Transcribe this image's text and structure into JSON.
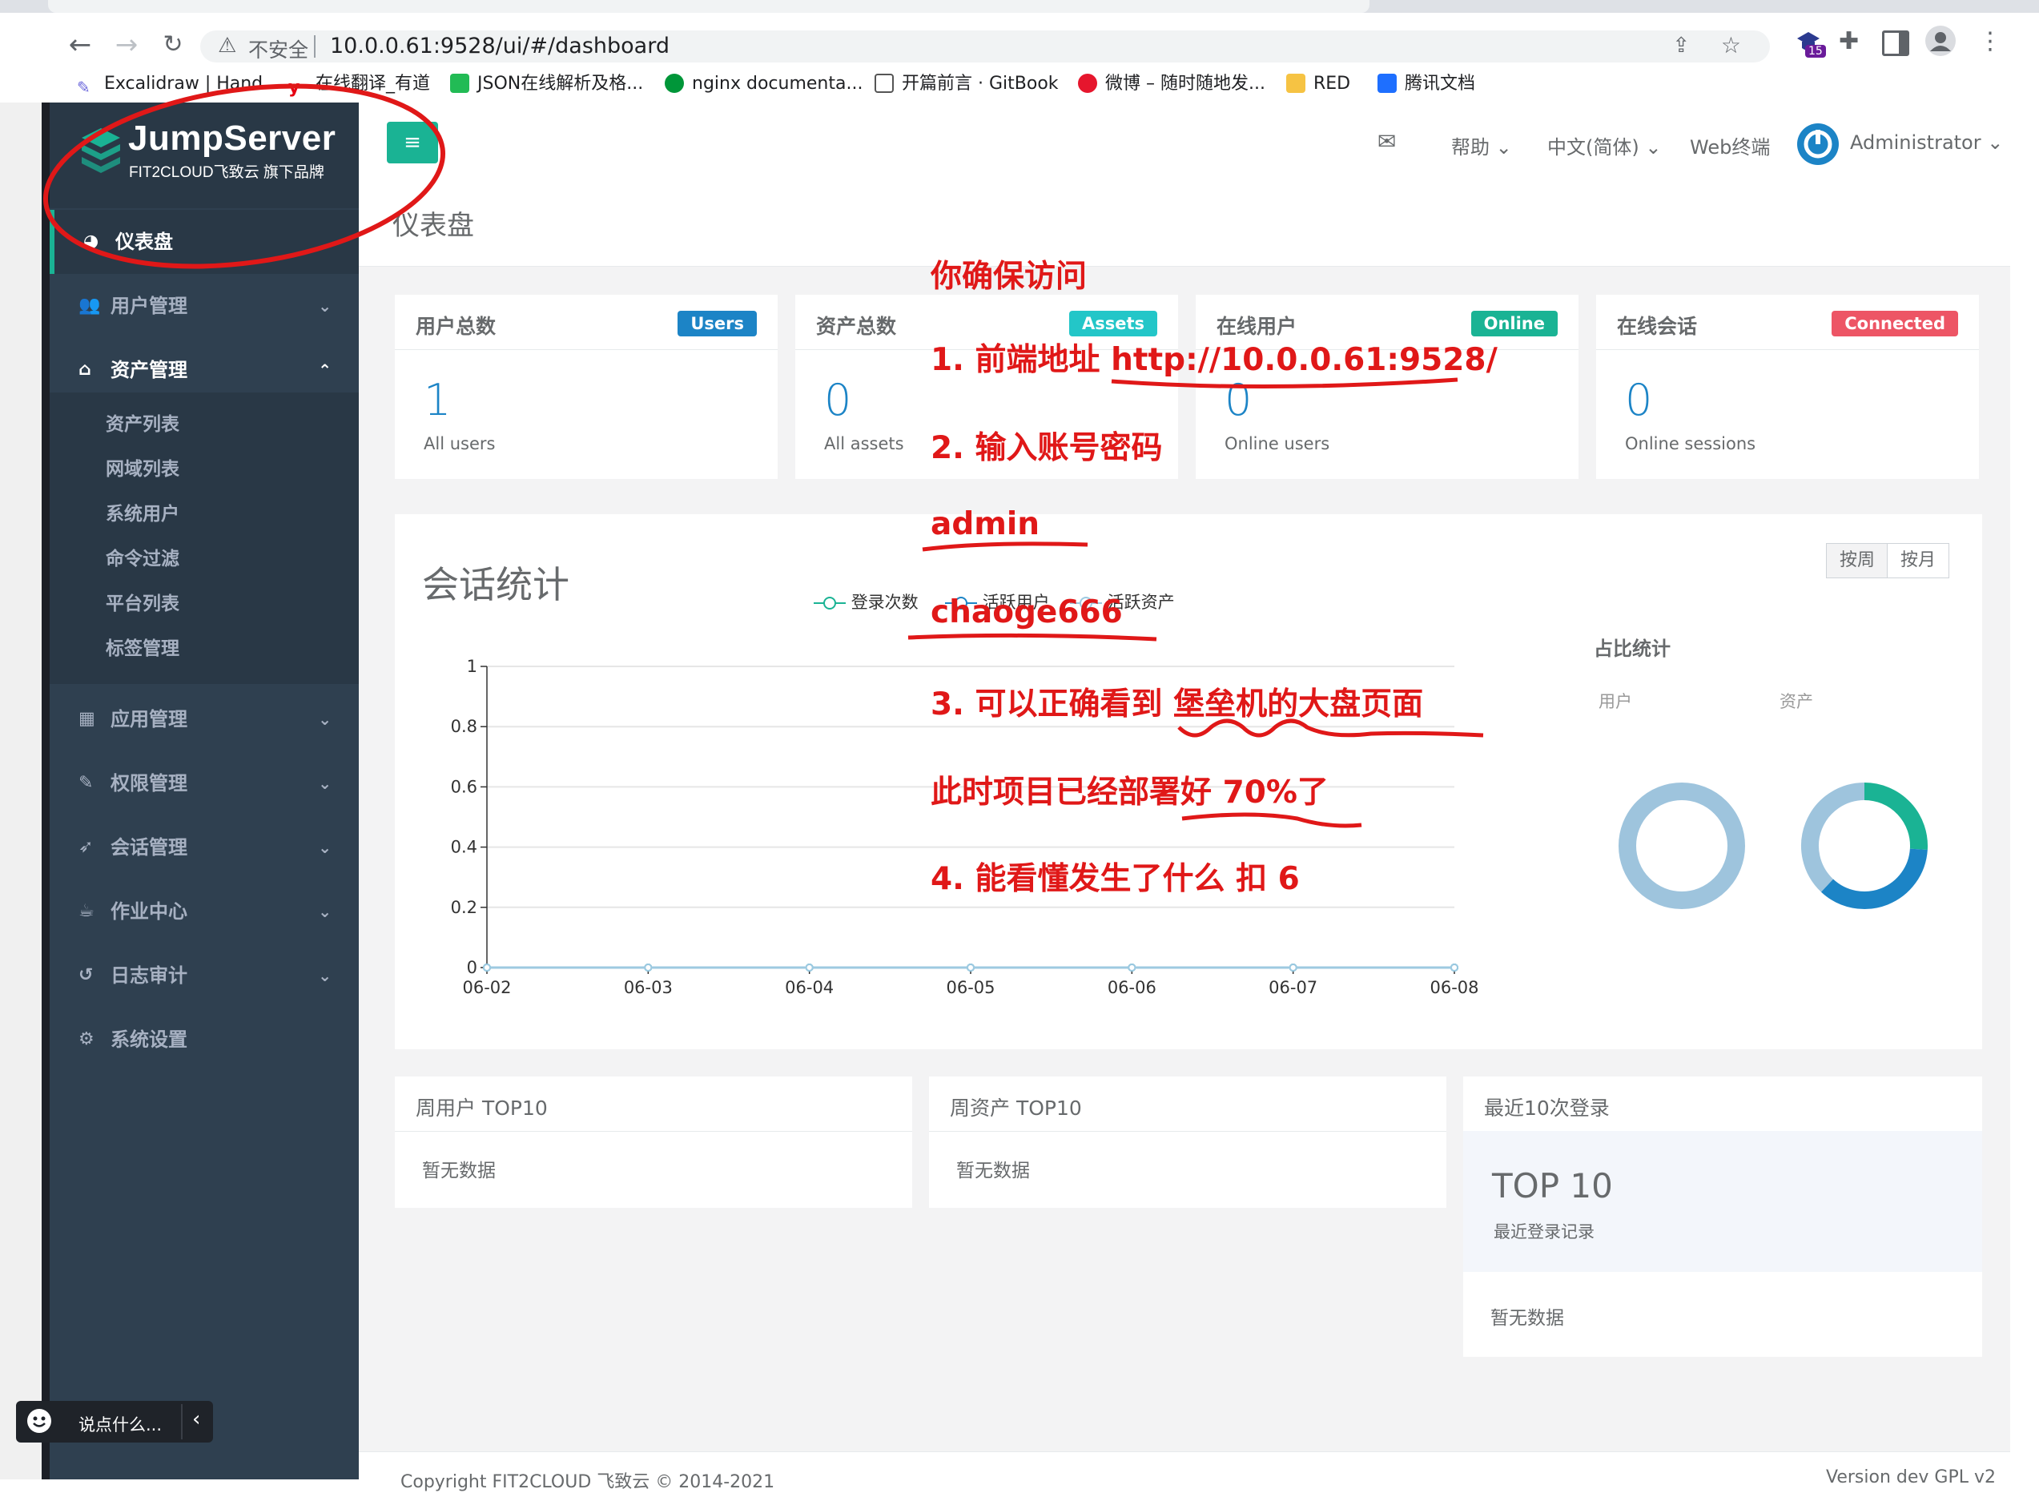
{
  "browser": {
    "insecure_label": "不安全",
    "url": "10.0.0.61:9528/ui/#/dashboard",
    "extension_badge": "15",
    "bookmarks": [
      {
        "label": "Excalidraw | Hand...",
        "icon": "excalidraw-icon",
        "color": "#6965db"
      },
      {
        "label": "在线翻译_有道",
        "icon": "youdao-icon",
        "color": "#e60012"
      },
      {
        "label": "JSON在线解析及格...",
        "icon": "json-icon",
        "color": "#22bb55"
      },
      {
        "label": "nginx documenta...",
        "icon": "nginx-icon",
        "color": "#009639"
      },
      {
        "label": "开篇前言 · GitBook",
        "icon": "book-icon",
        "color": "#555555"
      },
      {
        "label": "微博 – 随时随地发...",
        "icon": "weibo-icon",
        "color": "#e6162d"
      },
      {
        "label": "RED",
        "icon": "folder-icon",
        "color": "#f6c343"
      },
      {
        "label": "腾讯文档",
        "icon": "tencent-docs-icon",
        "color": "#1e6fff"
      }
    ]
  },
  "sidebar": {
    "logo_title": "JumpServer",
    "logo_sub": "FIT2CLOUD飞致云 旗下品牌",
    "dashboard": "仪表盘",
    "items": [
      {
        "label": "用户管理",
        "icon": "users-icon"
      },
      {
        "label": "资产管理",
        "icon": "inbox-icon"
      },
      {
        "label": "应用管理",
        "icon": "grid-icon"
      },
      {
        "label": "权限管理",
        "icon": "edit-icon"
      },
      {
        "label": "会话管理",
        "icon": "rocket-icon"
      },
      {
        "label": "作业中心",
        "icon": "coffee-icon"
      },
      {
        "label": "日志审计",
        "icon": "history-icon"
      },
      {
        "label": "系统设置",
        "icon": "gears-icon"
      }
    ],
    "asset_sub": [
      "资产列表",
      "网域列表",
      "系统用户",
      "命令过滤",
      "平台列表",
      "标签管理"
    ]
  },
  "topnav": {
    "help": "帮助",
    "language": "中文(简体)",
    "web_terminal": "Web终端",
    "user": "Administrator"
  },
  "page_title": "仪表盘",
  "stats": [
    {
      "title": "用户总数",
      "badge": "Users",
      "badge_color": "#1c84c6",
      "value": "1",
      "sub": "All users"
    },
    {
      "title": "资产总数",
      "badge": "Assets",
      "badge_color": "#23c6c8",
      "value": "0",
      "sub": "All assets"
    },
    {
      "title": "在线用户",
      "badge": "Online",
      "badge_color": "#1ab394",
      "value": "0",
      "sub": "Online users"
    },
    {
      "title": "在线会话",
      "badge": "Connected",
      "badge_color": "#ed5565",
      "value": "0",
      "sub": "Online sessions"
    }
  ],
  "session_stats": {
    "title": "会话统计",
    "toggle": [
      "按周",
      "按月"
    ],
    "ratio_title": "占比统计",
    "ratio_labels": [
      "用户",
      "资产"
    ]
  },
  "chart_data": {
    "type": "line",
    "categories": [
      "06-02",
      "06-03",
      "06-04",
      "06-05",
      "06-06",
      "06-07",
      "06-08"
    ],
    "series": [
      {
        "name": "登录次数",
        "values": [
          0,
          0,
          0,
          0,
          0,
          0,
          0
        ],
        "color": "#1ab394"
      },
      {
        "name": "活跃用户",
        "values": [
          0,
          0,
          0,
          0,
          0,
          0,
          0
        ],
        "color": "#1c84c6"
      },
      {
        "name": "活跃资产",
        "values": [
          0,
          0,
          0,
          0,
          0,
          0,
          0
        ],
        "color": "#9ecae1"
      }
    ],
    "yticks": [
      "0",
      "0.2",
      "0.4",
      "0.6",
      "0.8",
      "1"
    ],
    "ylim": [
      0,
      1
    ]
  },
  "ratio_data": [
    {
      "label": "用户",
      "segments": [
        {
          "value": 1,
          "color": "#9ec4dd"
        }
      ]
    },
    {
      "label": "资产",
      "segments": [
        {
          "value": 0.26,
          "color": "#1ab394"
        },
        {
          "value": 0.36,
          "color": "#1c84c6"
        },
        {
          "value": 0.38,
          "color": "#9ec4dd"
        }
      ]
    }
  ],
  "bottom": {
    "week_users": "周用户 TOP10",
    "week_assets": "周资产 TOP10",
    "recent_logins": "最近10次登录",
    "no_data": "暂无数据",
    "top10": "TOP 10",
    "top10_sub": "最近登录记录"
  },
  "footer": {
    "copyright": "Copyright FIT2CLOUD 飞致云 © 2014-2021",
    "version": "Version dev GPL v2"
  },
  "chat": {
    "placeholder": "说点什么..."
  },
  "annotations": {
    "head": "你确保访问",
    "l1_prefix": "1. 前端地址 ",
    "l1_url": "http://10.0.0.61:9528/",
    "l2": "2. 输入账号密码",
    "user": "admin",
    "pass": "chaoge666",
    "l3_prefix": "3.  可以正确看到 ",
    "l3_em": "堡垒机的大盘页面",
    "l4_prefix": "此时项目已经部署好 ",
    "l4_em": "70%了",
    "l5": "4. 能看懂发生了什么 扣 6"
  }
}
